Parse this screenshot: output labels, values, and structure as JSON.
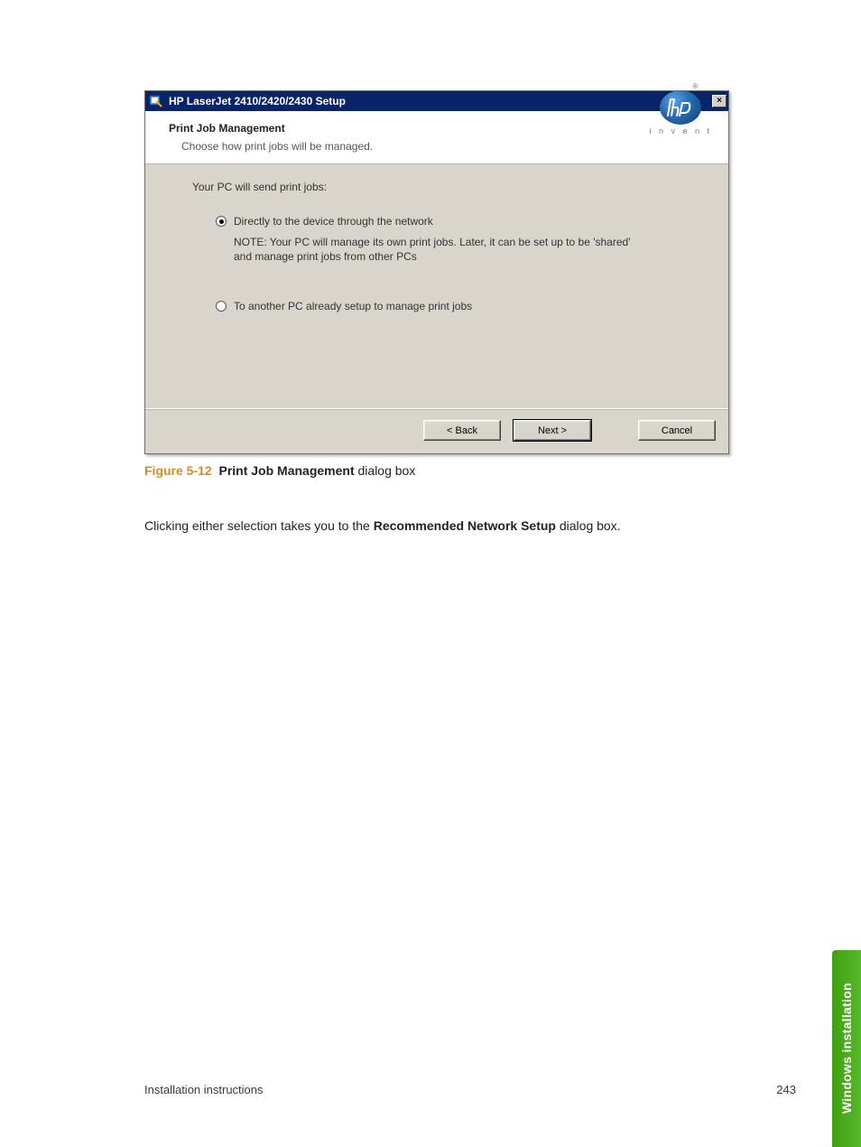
{
  "dialog": {
    "title": "HP LaserJet 2410/2420/2430 Setup",
    "close_glyph": "×",
    "header_title": "Print Job Management",
    "header_sub": "Choose how print jobs will be managed.",
    "logo_invent": "i n v e n t",
    "logo_reg": "®",
    "body_intro": "Your PC will send print jobs:",
    "option1_label": "Directly to the device through the network",
    "option1_note": "NOTE:  Your PC will manage its own print jobs.  Later, it can be set up to be 'shared' and manage print jobs from other PCs",
    "option2_label": "To another PC already setup to manage print jobs",
    "btn_back": "< Back",
    "btn_next": "Next >",
    "btn_cancel": "Cancel"
  },
  "caption": {
    "fignum": "Figure 5-12",
    "title": "Print Job Management",
    "suffix": " dialog box"
  },
  "paragraph": {
    "pre": "Clicking either selection takes you to the ",
    "bold": "Recommended Network Setup",
    "post": " dialog box."
  },
  "side_tab": "Windows installation",
  "footer": {
    "left": "Installation instructions",
    "right": "243"
  }
}
